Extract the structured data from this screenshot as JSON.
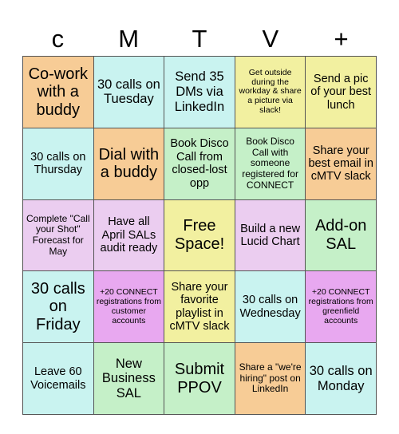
{
  "card": {
    "title_letters": [
      "c",
      "M",
      "T",
      "V",
      "+"
    ],
    "colors": {
      "orange": "#f7cc96",
      "cyan": "#c9f3f0",
      "yellow": "#f2f0a0",
      "green": "#c5f0c8",
      "lilac": "#ebcdf0",
      "magenta": "#e8a8f0"
    },
    "rows": [
      [
        {
          "text": "Co-work with a buddy",
          "color": "#f7cc96",
          "size": "fs-xl"
        },
        {
          "text": "30 calls on Tuesday",
          "color": "#c9f3f0",
          "size": "fs-lg"
        },
        {
          "text": "Send 35 DMs via LinkedIn",
          "color": "#c9f3f0",
          "size": "fs-lg"
        },
        {
          "text": "Get outside during the workday & share a picture via slack!",
          "color": "#f2f0a0",
          "size": "fs-xs"
        },
        {
          "text": "Send a pic of your best lunch",
          "color": "#f2f0a0",
          "size": "fs-md"
        }
      ],
      [
        {
          "text": "30 calls on Thursday",
          "color": "#c9f3f0",
          "size": "fs-md"
        },
        {
          "text": "Dial with a buddy",
          "color": "#f7cc96",
          "size": "fs-xl"
        },
        {
          "text": "Book Disco Call from closed-lost opp",
          "color": "#c5f0c8",
          "size": "fs-md"
        },
        {
          "text": "Book Disco Call with someone registered for CONNECT",
          "color": "#c5f0c8",
          "size": "fs-sm"
        },
        {
          "text": "Share your best email in cMTV slack",
          "color": "#f7cc96",
          "size": "fs-md"
        }
      ],
      [
        {
          "text": "Complete \"Call your Shot\" Forecast for May",
          "color": "#ebcdf0",
          "size": "fs-sm"
        },
        {
          "text": "Have all April SALs audit ready",
          "color": "#ebcdf0",
          "size": "fs-md"
        },
        {
          "text": "Free Space!",
          "color": "#f2f0a0",
          "size": "fs-xl"
        },
        {
          "text": "Build a new Lucid Chart",
          "color": "#ebcdf0",
          "size": "fs-md"
        },
        {
          "text": "Add-on SAL",
          "color": "#c5f0c8",
          "size": "fs-xl"
        }
      ],
      [
        {
          "text": "30 calls on Friday",
          "color": "#c9f3f0",
          "size": "fs-xl"
        },
        {
          "text": "+20 CONNECT registrations from customer accounts",
          "color": "#e8a8f0",
          "size": "fs-xs"
        },
        {
          "text": "Share your favorite playlist in cMTV slack",
          "color": "#f2f0a0",
          "size": "fs-md"
        },
        {
          "text": "30 calls on Wednesday",
          "color": "#c9f3f0",
          "size": "fs-md"
        },
        {
          "text": "+20 CONNECT registrations from greenfield accounts",
          "color": "#e8a8f0",
          "size": "fs-xs"
        }
      ],
      [
        {
          "text": "Leave 60 Voicemails",
          "color": "#c9f3f0",
          "size": "fs-md"
        },
        {
          "text": "New Business SAL",
          "color": "#c5f0c8",
          "size": "fs-lg"
        },
        {
          "text": "Submit PPOV",
          "color": "#c5f0c8",
          "size": "fs-xl"
        },
        {
          "text": "Share a \"we're hiring\" post on LinkedIn",
          "color": "#f7cc96",
          "size": "fs-sm"
        },
        {
          "text": "30 calls on Monday",
          "color": "#c9f3f0",
          "size": "fs-lg"
        }
      ]
    ]
  }
}
